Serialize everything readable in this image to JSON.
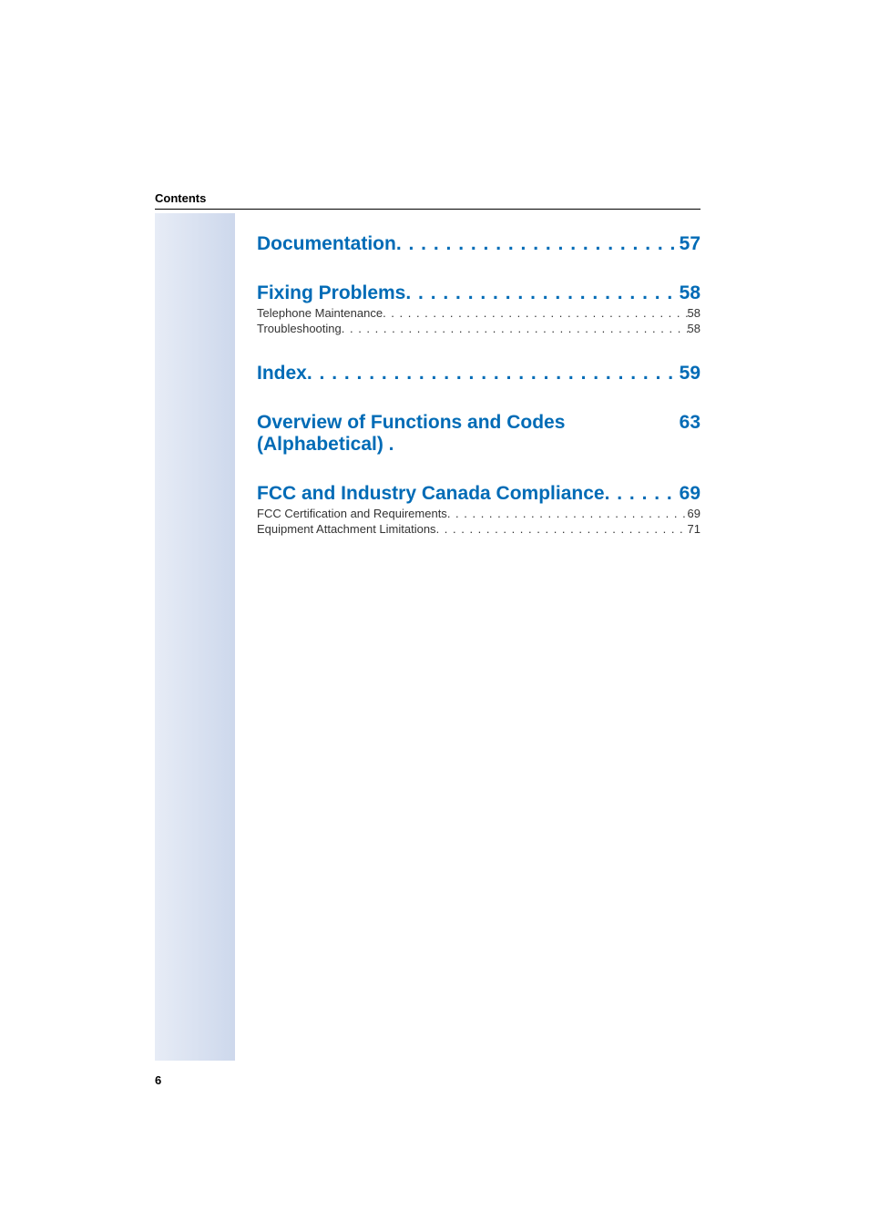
{
  "header": {
    "label": "Contents"
  },
  "dots": ". . . . . . . . . . . . . . . . . . . . . . . . . . . . . . . . . . . . . . . . . . . . . . . . . . . . . . . . . . . . . . . . . . . . . . . . . . . . . . . . . . . . . . . . . . . . . . . . . . . . . .",
  "sections": {
    "documentation": {
      "title": "Documentation",
      "page": "57"
    },
    "fixing": {
      "title": "Fixing Problems ",
      "page": "58",
      "subs": [
        {
          "title": "Telephone Maintenance ",
          "page": " 58"
        },
        {
          "title": "Troubleshooting",
          "page": " 58"
        }
      ]
    },
    "index": {
      "title": "Index",
      "page": "59"
    },
    "overview": {
      "title": "Overview of Functions and Codes (Alphabetical) .",
      "page": "63"
    },
    "fcc": {
      "title": "FCC and Industry Canada Compliance",
      "page": "69",
      "subs": [
        {
          "title": "FCC Certification and Requirements",
          "page": " 69"
        },
        {
          "title": "Equipment Attachment Limitations",
          "page": " 71"
        }
      ]
    }
  },
  "footer": {
    "pageNumber": "6"
  }
}
